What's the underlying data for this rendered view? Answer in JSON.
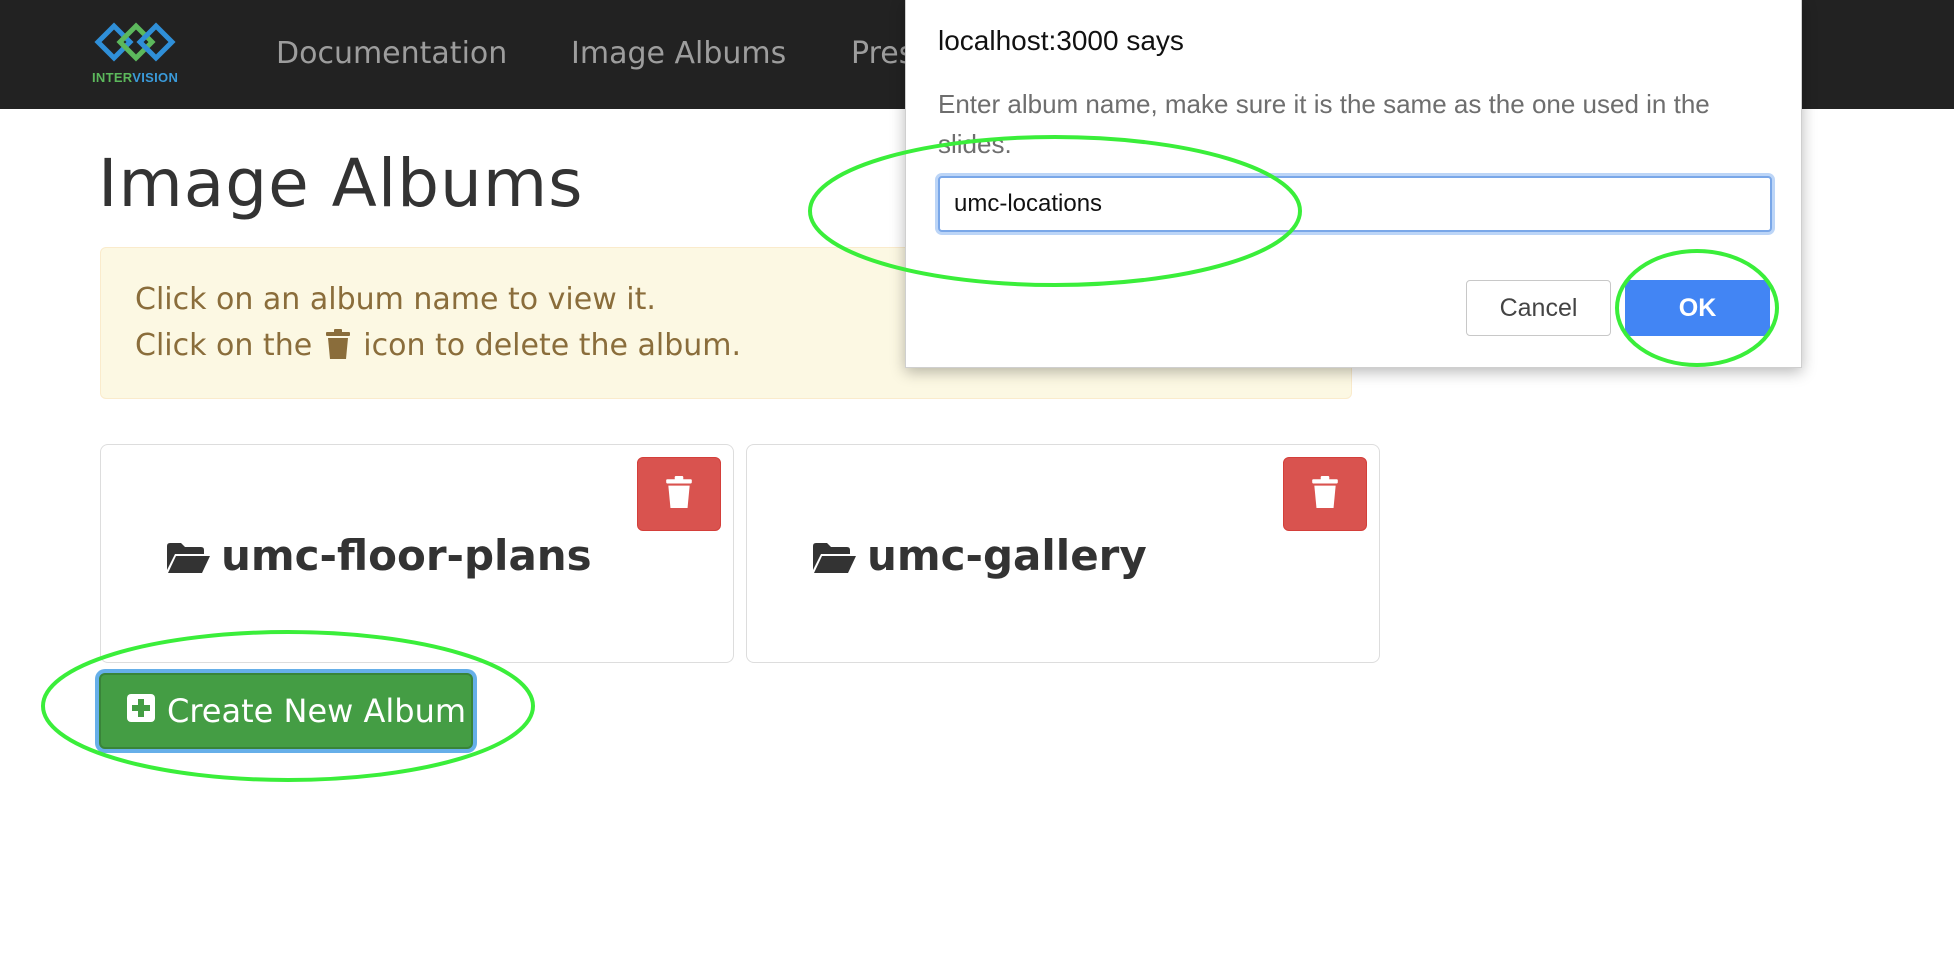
{
  "navbar": {
    "logo": {
      "text_part1": "INTER",
      "text_part2": "VISION",
      "icon": "intervision-logo-icon"
    },
    "links": [
      "Documentation",
      "Image Albums",
      "Pres"
    ]
  },
  "page": {
    "title": "Image Albums",
    "alert": {
      "line1": "Click on an album name to view it.",
      "line2_before": "Click on the",
      "line2_after": "icon to delete the album.",
      "icon": "trash-icon"
    },
    "albums": [
      {
        "name": "umc-floor-plans",
        "icon": "folder-open-icon",
        "delete_icon": "trash-icon"
      },
      {
        "name": "umc-gallery",
        "icon": "folder-open-icon",
        "delete_icon": "trash-icon"
      }
    ],
    "create_button": {
      "label": "Create New Album",
      "icon": "plus-square-icon"
    }
  },
  "dialog": {
    "title": "localhost:3000 says",
    "message": "Enter album name, make sure it is the same as the one used in the slides.",
    "input_value": "umc-locations",
    "cancel_label": "Cancel",
    "ok_label": "OK"
  },
  "colors": {
    "navbar_bg": "#222222",
    "nav_link": "#9d9d9d",
    "alert_bg": "#fcf8e3",
    "alert_text": "#8a6d3b",
    "danger": "#d9534f",
    "success": "#449d44",
    "dialog_ok": "#4285f4",
    "annotation": "#3aee3a"
  }
}
